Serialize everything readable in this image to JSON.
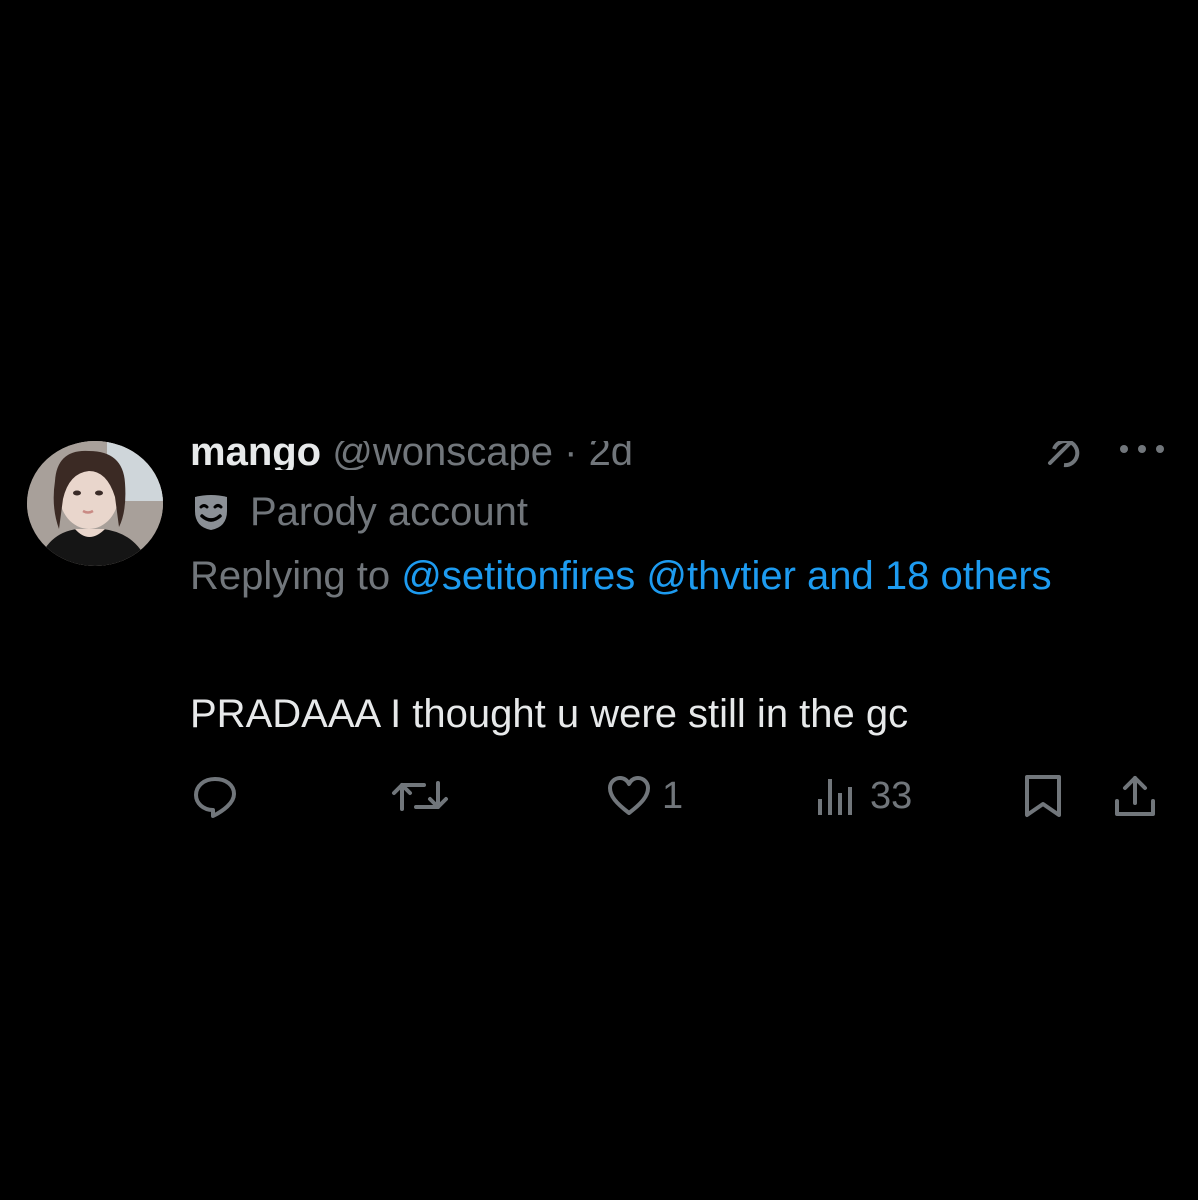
{
  "tweet": {
    "display_name": "mango",
    "handle": "@wonscape",
    "separator": "·",
    "time": "2d",
    "parody_label": "Parody account",
    "replying_prefix": "Replying to ",
    "replying_mentions": [
      "@setitonfires",
      "@thvtier"
    ],
    "replying_suffix": "and 18 others",
    "text": "PRADAAA I thought u were still in the gc",
    "reply_count": "",
    "retweet_count": "",
    "like_count": "1",
    "view_count": "33"
  },
  "icons": {
    "avatar": "avatar",
    "grok": "grok-icon",
    "more": "more-icon",
    "parody": "mask-icon",
    "reply": "reply-icon",
    "retweet": "retweet-icon",
    "like": "heart-icon",
    "views": "views-icon",
    "bookmark": "bookmark-icon",
    "share": "share-icon"
  },
  "colors": {
    "background": "#000000",
    "text": "#e7e9ea",
    "muted": "#71767b",
    "link": "#1d9bf0"
  }
}
